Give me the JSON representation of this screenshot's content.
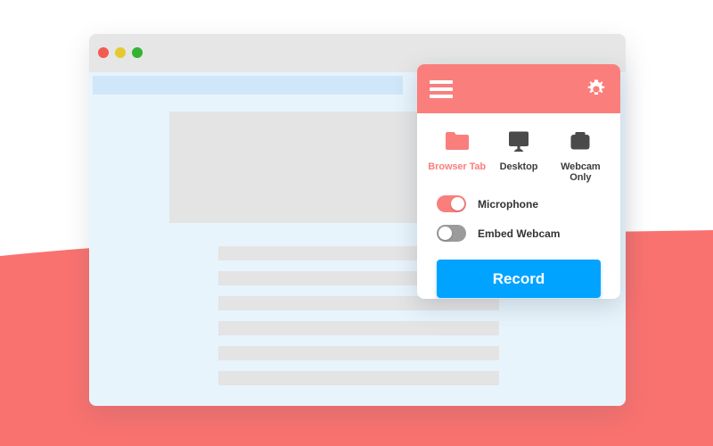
{
  "colors": {
    "accent_coral": "#fa7f7c",
    "record_blue": "#00a3ff",
    "page_blue": "#e8f4fc",
    "placeholder_gray": "#e4e4e4",
    "titlebar_gray": "#e6e6e6",
    "toggle_off_gray": "#9b9b9b",
    "background_white": "#ffffff"
  },
  "background": {
    "wave_name": "coral-wave-shape",
    "wave_color": "#f9726f"
  },
  "browser_window": {
    "traffic_lights": [
      {
        "name": "close",
        "color": "#f15b52"
      },
      {
        "name": "minimize",
        "color": "#e6c931"
      },
      {
        "name": "maximize",
        "color": "#34b233"
      }
    ],
    "url_bar_value": "",
    "url_bar_placeholder": "",
    "placeholders": {
      "hero_block_name": "hero-image-placeholder",
      "text_line_count": 6
    }
  },
  "extension_panel": {
    "header": {
      "menu_icon": "hamburger-menu-icon",
      "settings_icon": "gear-icon"
    },
    "sources": [
      {
        "label": "Browser Tab",
        "icon": "folder-icon",
        "active": true
      },
      {
        "label": "Desktop",
        "icon": "monitor-icon",
        "active": false
      },
      {
        "label": "Webcam Only",
        "icon": "camera-icon",
        "active": false
      }
    ],
    "toggles": [
      {
        "label": "Microphone",
        "on": true
      },
      {
        "label": "Embed Webcam",
        "on": false
      }
    ],
    "record_button_label": "Record"
  }
}
